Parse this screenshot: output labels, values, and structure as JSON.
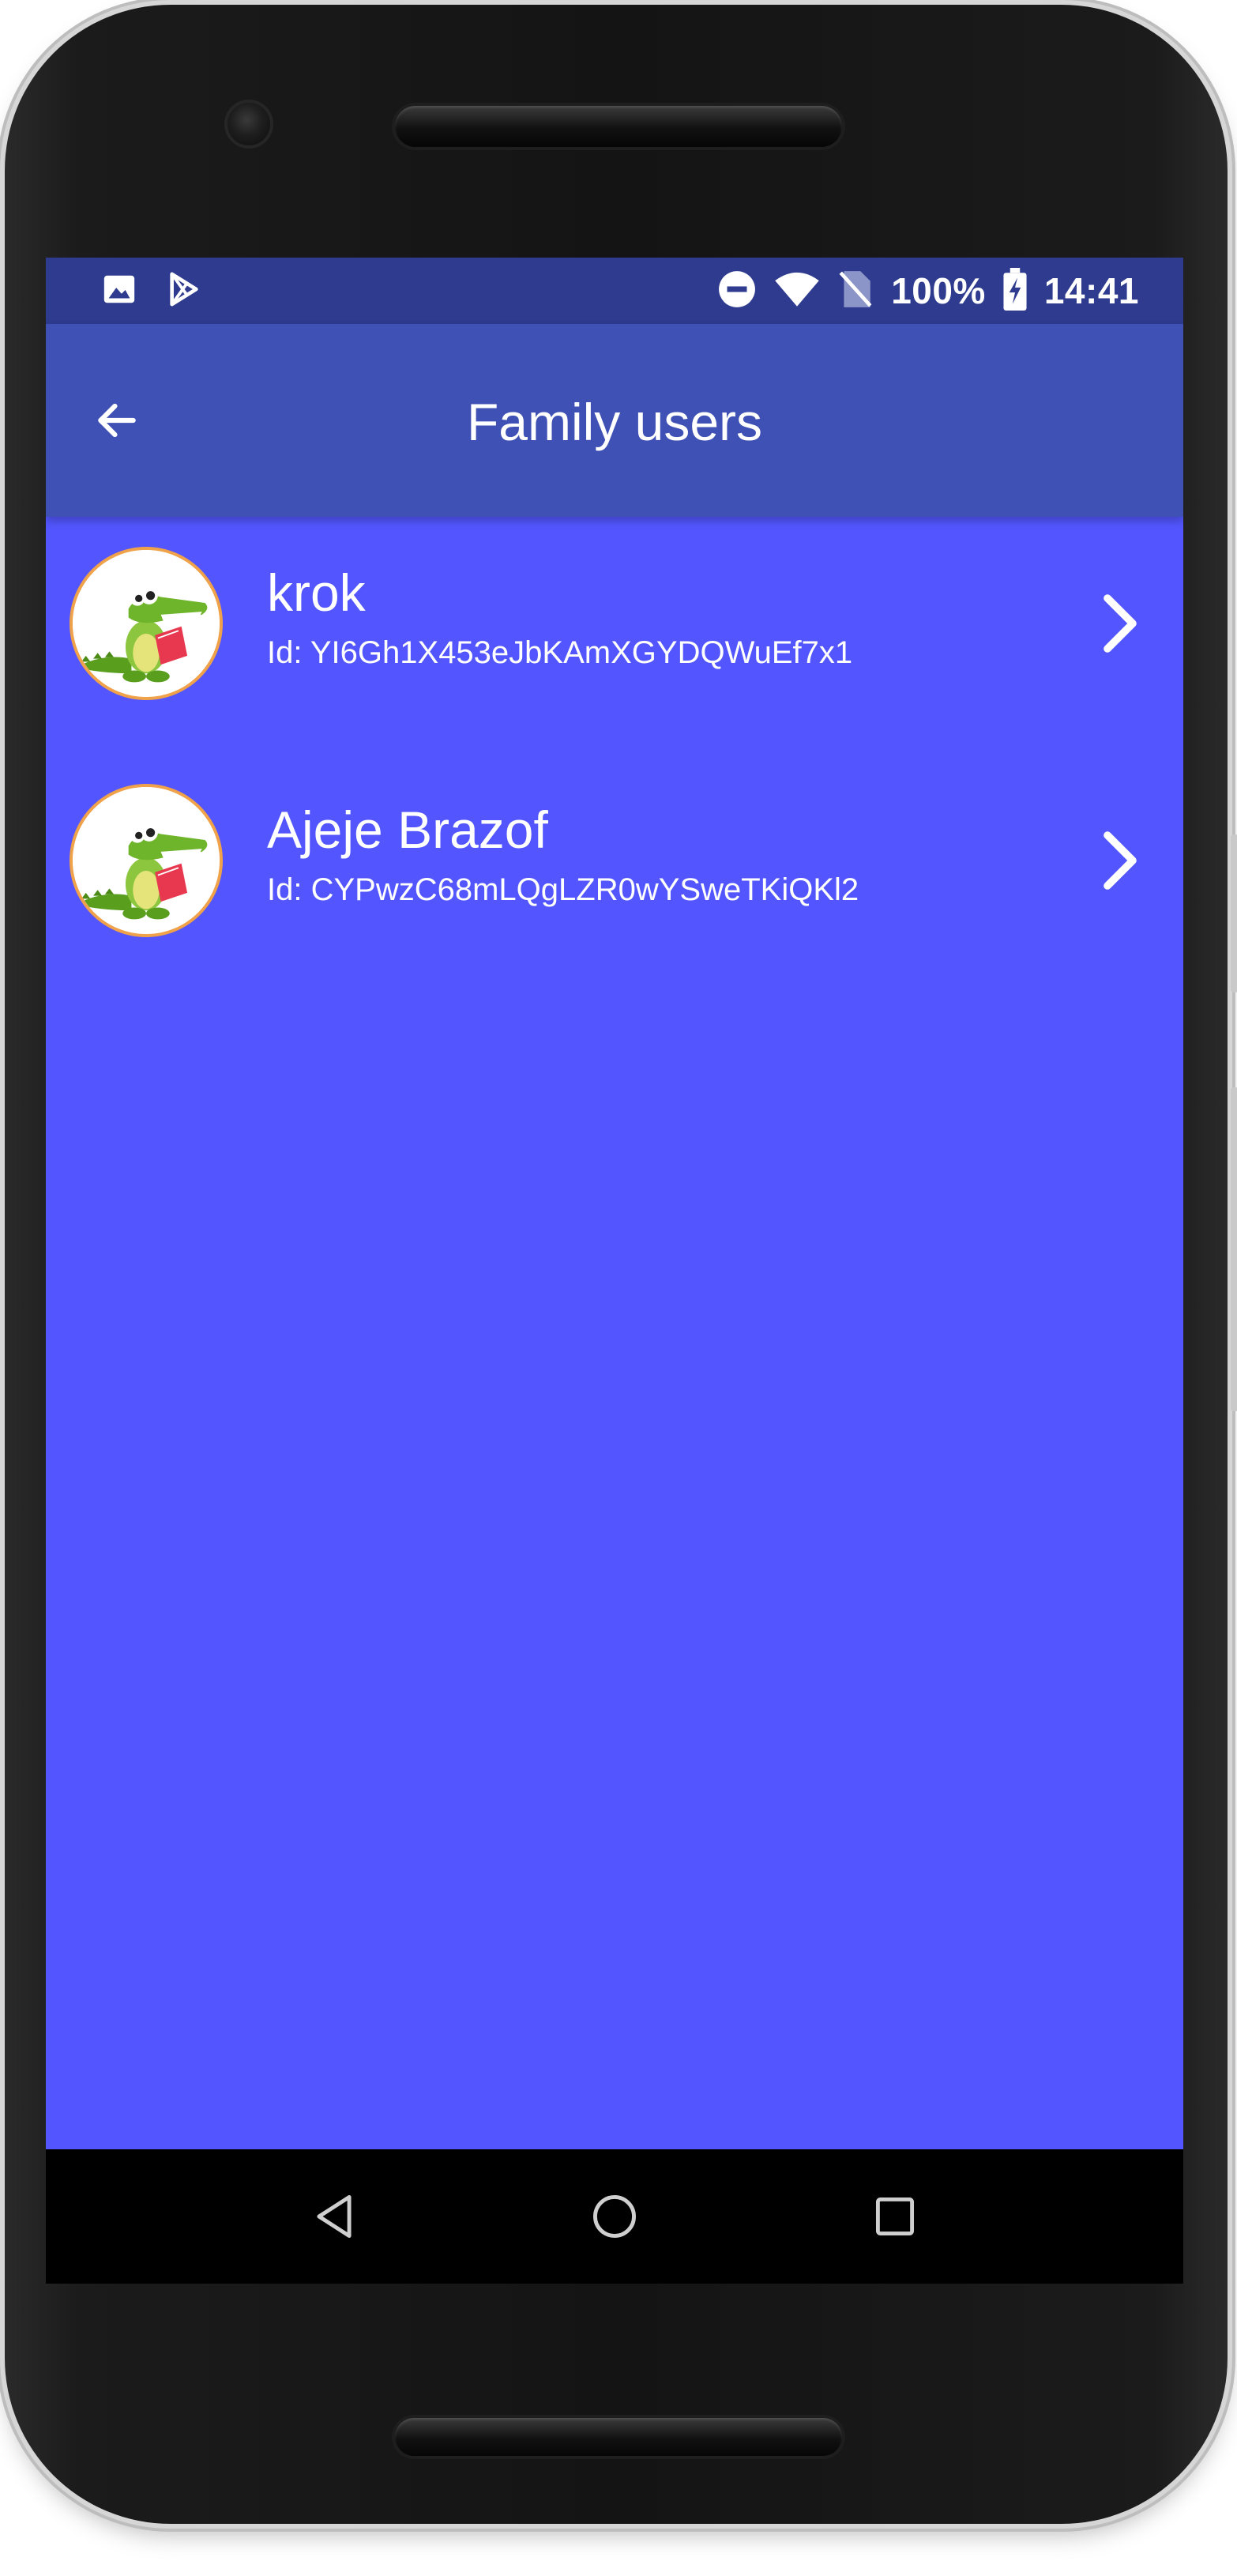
{
  "status_bar": {
    "battery": "100%",
    "time": "14:41",
    "left_icons": [
      "image-icon",
      "play-store-icon"
    ],
    "right_icons": [
      "do-not-disturb-icon",
      "wifi-icon",
      "no-sim-icon",
      "battery-charging-icon"
    ]
  },
  "app_bar": {
    "title": "Family users",
    "back_icon": "arrow-back-icon"
  },
  "users": [
    {
      "name": "krok",
      "id": "Id: YI6Gh1X453eJbKAmXGYDQWuEf7x1"
    },
    {
      "name": "Ajeje Brazof",
      "id": "Id: CYPwzC68mLQgLZR0wYSweTKiQKl2"
    }
  ],
  "nav_bar": {
    "buttons": [
      "back-triangle-icon",
      "home-circle-icon",
      "recents-square-icon"
    ]
  },
  "colors": {
    "status_bar": "#2e3b8e",
    "app_bar": "#3f51b5",
    "content_background": "#5356fe",
    "avatar_border": "#f0a24a",
    "nav_bar": "#000000"
  }
}
